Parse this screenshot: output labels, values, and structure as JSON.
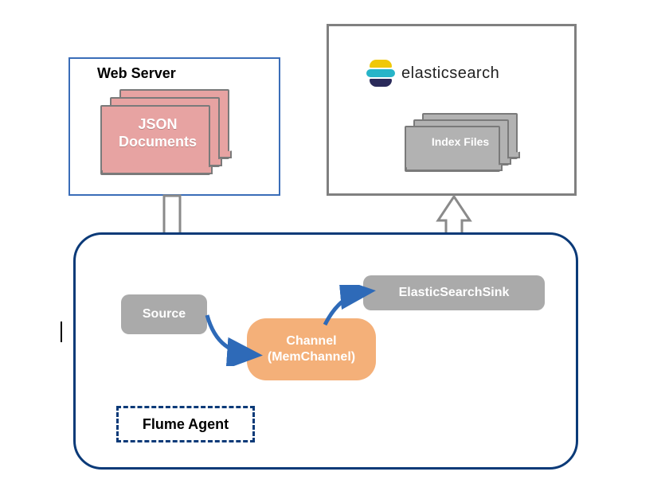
{
  "webserver": {
    "title": "Web Server",
    "doc_label_line1": "JSON",
    "doc_label_line2": "Documents"
  },
  "elasticsearch": {
    "logo_text": "elasticsearch",
    "index_label": "Index Files"
  },
  "flume": {
    "source_label": "Source",
    "channel_label_line1": "Channel",
    "channel_label_line2": "(MemChannel)",
    "sink_label": "ElasticSearchSink",
    "agent_label": "Flume Agent"
  },
  "arrows": {
    "webserver_to_source": "down-arrow",
    "sink_to_elastic": "up-arrow",
    "source_to_channel": "connector",
    "channel_to_sink": "connector"
  },
  "colors": {
    "webserver_border": "#3a6db8",
    "elastic_border": "#808080",
    "flume_border": "#0b3a78",
    "json_doc": "#e7a3a2",
    "index_doc": "#b2b2b2",
    "gray_node": "#aaaaaa",
    "channel_node": "#f4b079",
    "connector": "#2e6ab8"
  }
}
